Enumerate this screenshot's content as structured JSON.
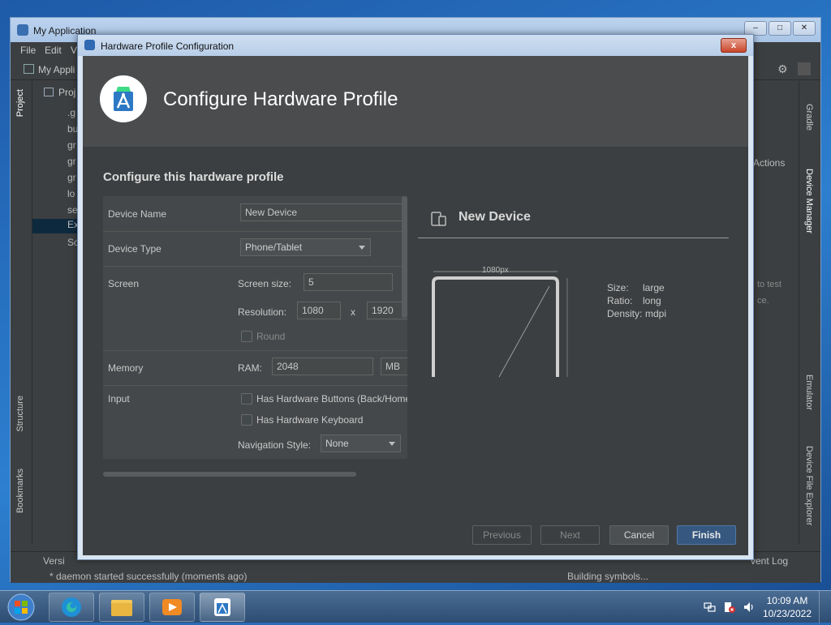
{
  "ide": {
    "title": "My Application",
    "menu": [
      "File",
      "Edit",
      "V"
    ],
    "nav_project": "My Appli",
    "project_tab": "Project",
    "tree_header": "Proj",
    "tree_items": [
      ".g",
      "bu",
      "gr",
      "gr",
      "gr",
      "lo",
      "se",
      "Ex",
      "Sc"
    ],
    "left_tabs": {
      "project": "Project",
      "structure": "Structure",
      "bookmarks": "Bookmarks"
    },
    "right_tabs": {
      "gradle": "Gradle",
      "device_manager": "Device Manager",
      "emulator": "Emulator",
      "device_file_explorer": "Device File Explorer"
    },
    "actions_header": "Actions",
    "right_hint_1": "to test",
    "right_hint_2": "ce.",
    "status_left_tab": "Versi",
    "status_right_tab": "vent Log",
    "status_message": "* daemon started successfully (moments ago)",
    "status_progress": "Building symbols..."
  },
  "dialog": {
    "window_title": "Hardware Profile Configuration",
    "close_label": "x",
    "header_title": "Configure Hardware Profile",
    "section_title": "Configure this hardware profile",
    "form": {
      "device_name_label": "Device Name",
      "device_name_value": "New Device",
      "device_type_label": "Device Type",
      "device_type_value": "Phone/Tablet",
      "screen_label": "Screen",
      "screen_size_label": "Screen size:",
      "screen_size_value": "5",
      "resolution_label": "Resolution:",
      "resolution_x_value": "1080",
      "resolution_sep": "x",
      "resolution_y_value": "1920",
      "round_label": "Round",
      "memory_label": "Memory",
      "ram_label": "RAM:",
      "ram_value": "2048",
      "ram_unit": "MB",
      "input_label": "Input",
      "hw_buttons_label": "Has Hardware Buttons (Back/Home",
      "hw_keyboard_label": "Has Hardware Keyboard",
      "nav_style_label": "Navigation Style:",
      "nav_style_value": "None"
    },
    "preview": {
      "title": "New Device",
      "width_label": "1080px",
      "size_label": "Size:",
      "size_value": "large",
      "ratio_label": "Ratio:",
      "ratio_value": "long",
      "density_label": "Density:",
      "density_value": "mdpi"
    },
    "buttons": {
      "previous": "Previous",
      "next": "Next",
      "cancel": "Cancel",
      "finish": "Finish"
    }
  },
  "taskbar": {
    "time": "10:09 AM",
    "date": "10/23/2022"
  },
  "colors": {
    "accent": "#365880",
    "dialog_bg": "#3c3f41",
    "header_bg": "#4a4c4e"
  }
}
